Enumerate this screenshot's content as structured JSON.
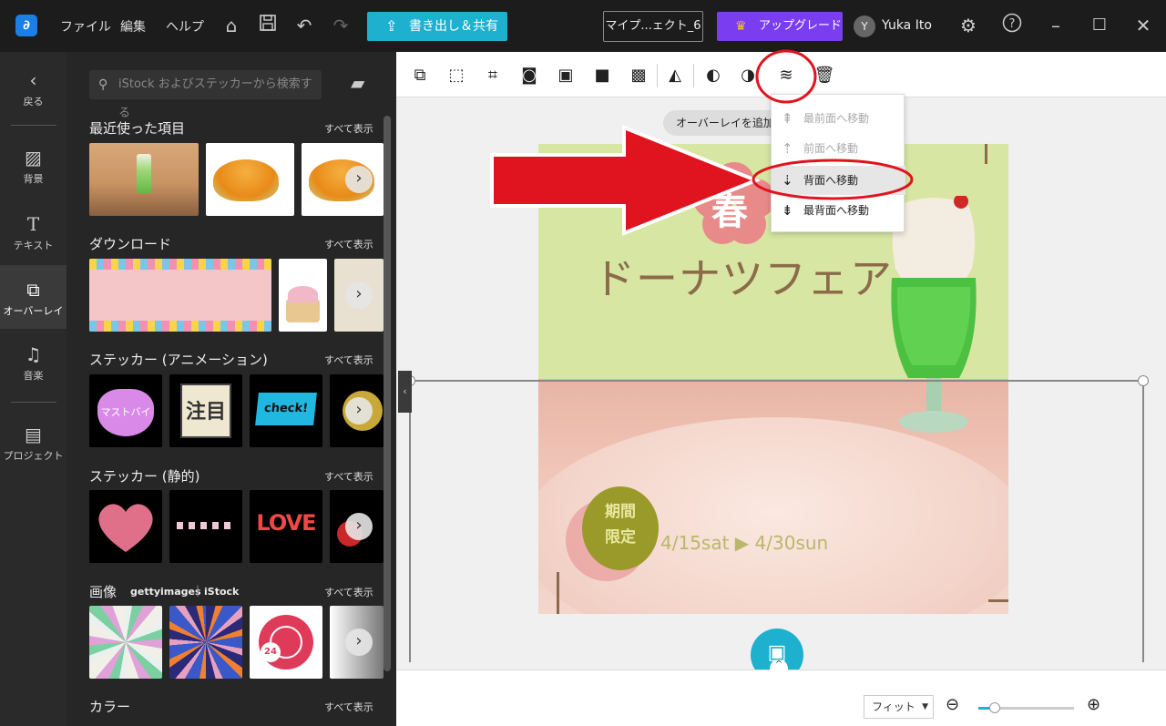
{
  "titlebar": {
    "menus": [
      "ファイル",
      "編集",
      "ヘルプ"
    ],
    "export_label": "書き出し＆共有",
    "project_label": "マイプ...ェクト_6",
    "upgrade_label": "アップグレード",
    "avatar_initial": "Y",
    "user_name": "Yuka Ito"
  },
  "rail": {
    "back": "戻る",
    "background": "背景",
    "text": "テキスト",
    "overlay": "オーバーレイ",
    "music": "音楽",
    "project": "プロジェクト"
  },
  "panel": {
    "search_placeholder": "iStock およびステッカーから検索する",
    "see_all": "すべて表示",
    "sections": {
      "recent": "最近使った項目",
      "download": "ダウンロード",
      "sticker_anim": "ステッカー (アニメーション)",
      "sticker_static": "ステッカー (静的)",
      "images": "画像",
      "color": "カラー"
    },
    "images_brand_getty": "gettyimages",
    "images_brand_istock": "iStock",
    "sticker_check": "check!",
    "sticker_love": "LOVE",
    "sticker_heart": "マストバイ",
    "sticker_chui": "注目",
    "image_clock_num": "24"
  },
  "canvas": {
    "overlay_pill": "オーバーレイを追加",
    "poster_flower_char": "春",
    "poster_headline": "ドーナツフェア",
    "badge_line1": "期間",
    "badge_line2": "限定",
    "dates": "4/15sat ▶ 4/30sun"
  },
  "dropdown": {
    "items": [
      "最前面へ移動",
      "前面へ移動",
      "背面へ移動",
      "最背面へ移動"
    ]
  },
  "bottom": {
    "fit_label": "フィット",
    "zoom_fraction": 0.17
  },
  "colors": {
    "accent": "#1db1cf",
    "upgrade": "#7a3ef0",
    "annotation_red": "#e0141e"
  }
}
